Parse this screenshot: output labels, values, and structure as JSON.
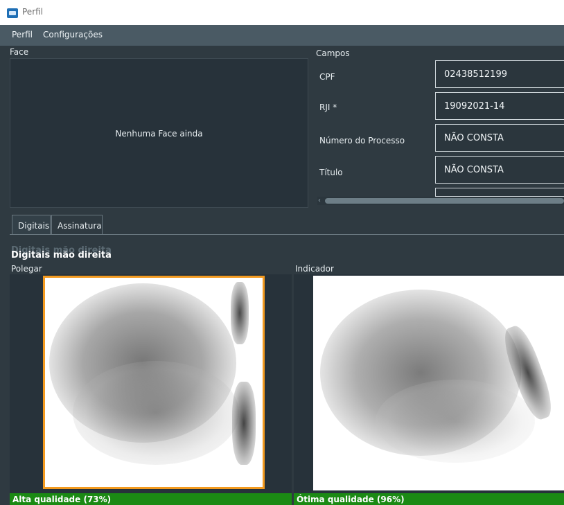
{
  "window": {
    "title": "Perfil",
    "icon": "app-icon"
  },
  "menu": [
    "Perfil",
    "Configurações"
  ],
  "face": {
    "label": "Face",
    "placeholder_text": "Nenhuma Face ainda"
  },
  "campos": {
    "label": "Campos",
    "fields": [
      {
        "label": "CPF",
        "value": "02438512199"
      },
      {
        "label": "RJI *",
        "value": "19092021-14"
      },
      {
        "label": "Número do Processo",
        "value": "NÃO CONSTA"
      },
      {
        "label": "Título",
        "value": "NÃO CONSTA"
      }
    ]
  },
  "tabs": [
    {
      "label": "Digitais",
      "active": true
    },
    {
      "label": "Assinatura",
      "active": false
    }
  ],
  "digitais": {
    "section_title": "Digitais mão direita",
    "fingers": [
      {
        "label": "Polegar",
        "quality_text": "Alta qualidade (73%)",
        "quality": 0.73,
        "selected": true
      },
      {
        "label": "Indicador",
        "quality_text": "Ótima qualidade (96%)",
        "quality": 0.96,
        "selected": false
      }
    ]
  },
  "colors": {
    "background": "#2f3a41",
    "menubar": "#4a5a64",
    "panel": "#27323a",
    "quality_bar": "#1b8a14",
    "selection": "#f39a1f"
  }
}
